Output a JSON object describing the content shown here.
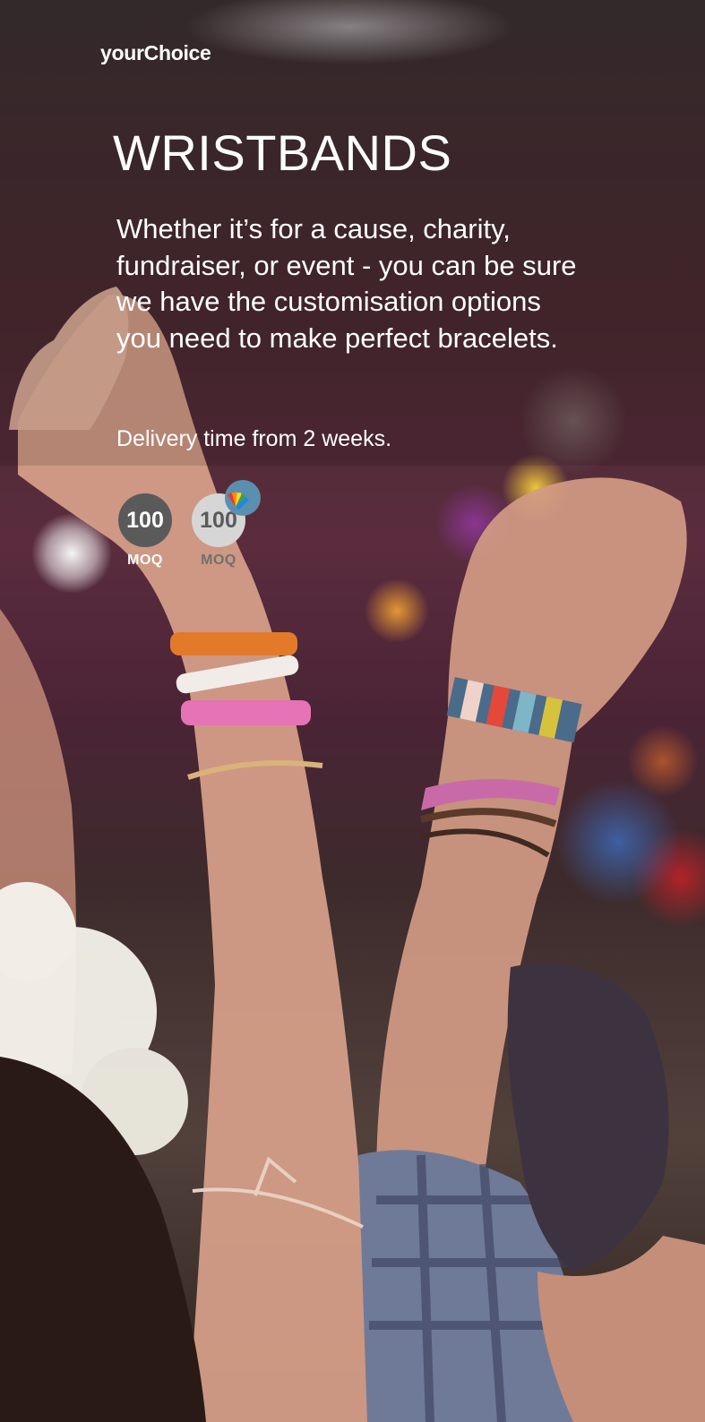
{
  "brand": {
    "logo": "yourChoice"
  },
  "hero": {
    "title": "WRISTBANDS",
    "description": "Whether it’s for a cause, charity, fundraiser, or event - you can be sure we have the customisation options you need to make perfect bracelets.",
    "delivery": "Delivery time from 2 weeks."
  },
  "badges": [
    {
      "value": "100",
      "caption": "MOQ",
      "color": "#5a5a5a"
    },
    {
      "value": "100",
      "caption": "MOQ",
      "color": "#d6d6d6",
      "icon": "color-swatch-icon"
    }
  ],
  "colors": {
    "text": "#ffffff",
    "swatch_badge": "#5b8fae"
  }
}
